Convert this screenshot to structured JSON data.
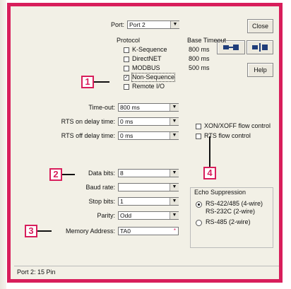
{
  "port": {
    "label": "Port:",
    "value": "Port 2"
  },
  "buttons": {
    "close": "Close",
    "help": "Help"
  },
  "protocol": {
    "label": "Protocol",
    "items": [
      {
        "label": "K-Sequence",
        "checked": false
      },
      {
        "label": "DirectNET",
        "checked": false
      },
      {
        "label": "MODBUS",
        "checked": false
      },
      {
        "label": "Non-Sequence",
        "checked": true
      },
      {
        "label": "Remote I/O",
        "checked": false
      }
    ]
  },
  "base_timeout": {
    "label": "Base Timeout",
    "values": [
      "800 ms",
      "800 ms",
      "500 ms"
    ]
  },
  "fields": {
    "timeout": {
      "label": "Time-out:",
      "value": "800 ms"
    },
    "rts_on": {
      "label": "RTS on delay time:",
      "value": "0 ms"
    },
    "rts_off": {
      "label": "RTS off delay time:",
      "value": "0 ms"
    },
    "data_bits": {
      "label": "Data bits:",
      "value": "8"
    },
    "baud_rate": {
      "label": "Baud rate:",
      "value": ""
    },
    "stop_bits": {
      "label": "Stop bits:",
      "value": "1"
    },
    "parity": {
      "label": "Parity:",
      "value": "Odd"
    },
    "memory_address": {
      "label": "Memory Address:",
      "value": "TA0"
    }
  },
  "flow": {
    "xon": {
      "label": "XON/XOFF flow control",
      "checked": false
    },
    "rts": {
      "label": "RTS flow control",
      "checked": false
    }
  },
  "echo": {
    "label": "Echo Suppression",
    "opt1_line1": "RS-422/485 (4-wire)",
    "opt1_line2": "RS-232C (2-wire)",
    "opt2": "RS-485 (2-wire)",
    "selected": 0
  },
  "callouts": [
    "1",
    "2",
    "3",
    "4"
  ],
  "status_text": "Port 2: 15 Pin",
  "colors": {
    "accent": "#d81e5b",
    "panel": "#f2f0e6"
  },
  "icons": [
    "connect-icon",
    "disconnect-icon",
    "checkmark-icon",
    "dropdown-arrow-icon"
  ]
}
